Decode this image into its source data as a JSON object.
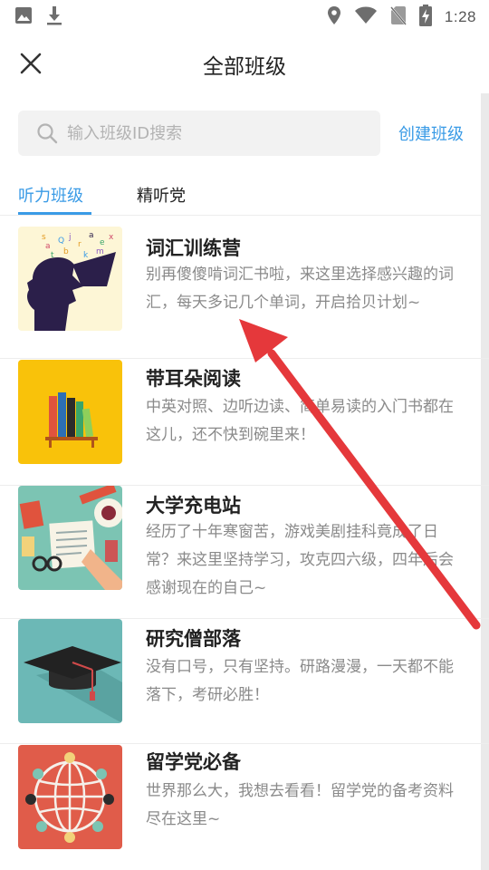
{
  "status_bar": {
    "time": "1:28",
    "left_icons": [
      "image-icon",
      "download-icon"
    ],
    "right_icons": [
      "location-icon",
      "wifi-icon",
      "no-sim-icon",
      "battery-charging-icon"
    ]
  },
  "header": {
    "title": "全部班级",
    "close_icon": "close-icon"
  },
  "search": {
    "placeholder": "输入班级ID搜索",
    "create_label": "创建班级"
  },
  "tabs": [
    {
      "label": "听力班级",
      "active": true
    },
    {
      "label": "精听党",
      "active": false
    }
  ],
  "classes": [
    {
      "title": "词汇训练营",
      "desc": "别再傻傻啃词汇书啦，来这里选择感兴趣的词汇，每天多记几个单词，开启拾贝计划~",
      "thumb_bg": "#fdf6d6"
    },
    {
      "title": "带耳朵阅读",
      "desc": "中英对照、边听边读、简单易读的入门书都在这儿，还不快到碗里来！",
      "thumb_bg": "#f9c20a"
    },
    {
      "title": "大学充电站",
      "desc": "经历了十年寒窗苦，游戏美剧挂科竟成了日常？来这里坚持学习，攻克四六级，四年后会感谢现在的自己~",
      "thumb_bg": "#7cc4b3"
    },
    {
      "title": "研究僧部落",
      "desc": "没有口号，只有坚持。研路漫漫，一天都不能落下，考研必胜！",
      "thumb_bg": "#6cb8b6"
    },
    {
      "title": "留学党必备",
      "desc": "世界那么大，我想去看看！留学党的备考资料尽在这里~",
      "thumb_bg": "#e05c4a"
    }
  ],
  "colors": {
    "accent": "#3a9be6",
    "annotation_arrow": "#e5383b"
  }
}
